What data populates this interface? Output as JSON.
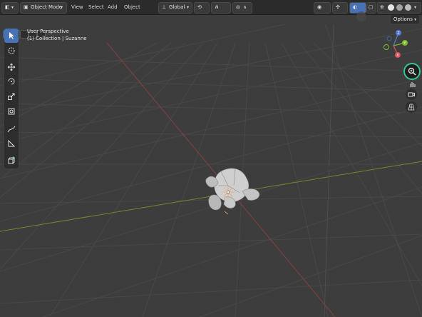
{
  "header": {
    "mode_label": "Object Mode",
    "menu": [
      "View",
      "Select",
      "Add",
      "Object"
    ],
    "transform_orientation": "Global"
  },
  "viewport": {
    "perspective_label": "User Perspective",
    "collection_label": "(1) Collection | Suzanne"
  },
  "gizmo": {
    "axes": [
      "Z",
      "Y",
      "X"
    ]
  },
  "options_label": "Options",
  "colors": {
    "background": "#3d3d3d",
    "grid": "#4b4b4b",
    "x_axis": "#8a3d3d",
    "y_axis": "#6d8a2c",
    "highlight_ring": "#36c78e",
    "axis_x": "#e0525d",
    "axis_y": "#7db82e",
    "axis_z": "#4f7ad8"
  },
  "icons": {
    "select": "cursor-icon",
    "cursor3d": "crosshair-icon",
    "move": "move-icon",
    "rotate": "rotate-icon",
    "scale": "scale-icon",
    "transform": "transform-icon",
    "annotate": "annotate-icon",
    "measure": "measure-icon",
    "add_cube": "add-cube-icon",
    "zoom": "zoom-icon",
    "hand": "hand-icon",
    "camera": "camera-icon",
    "grid": "grid-icon"
  }
}
